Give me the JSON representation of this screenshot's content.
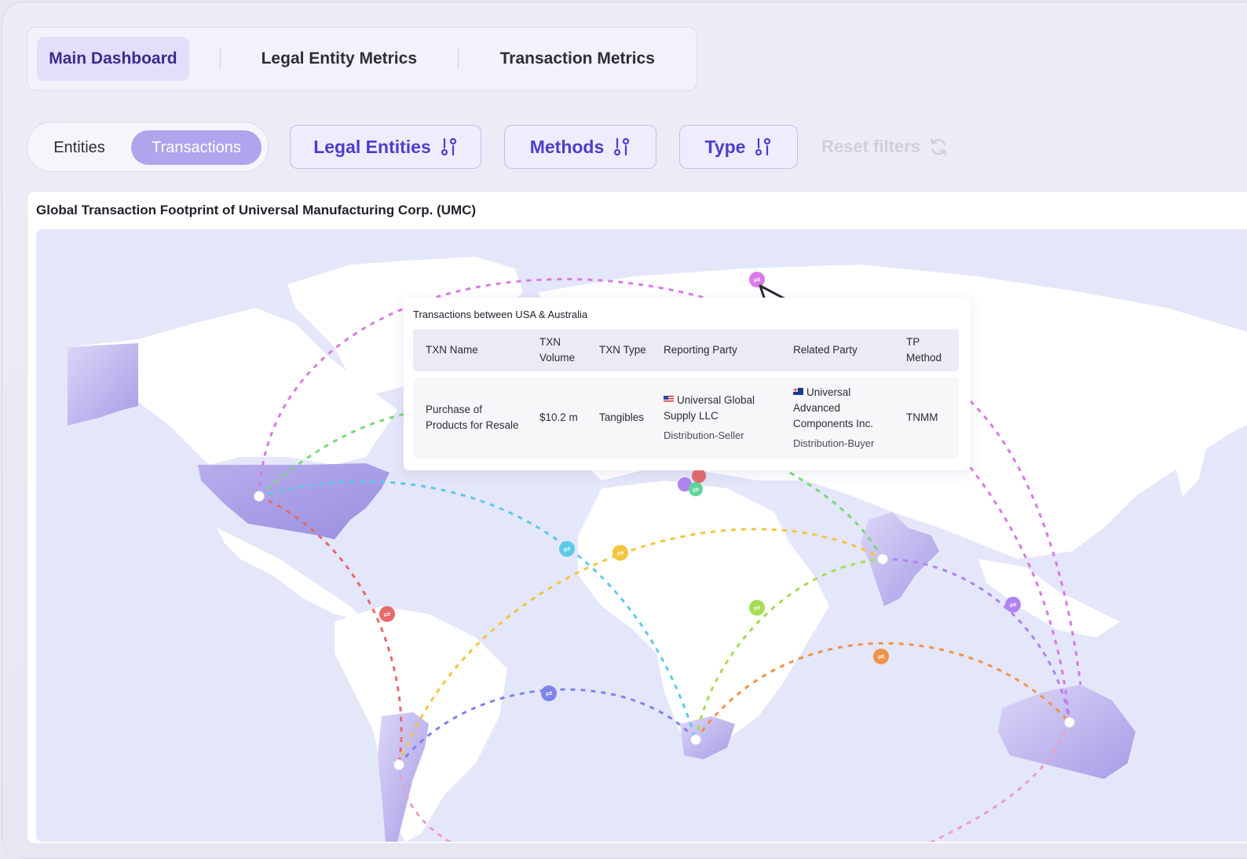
{
  "tabs": [
    {
      "label": "Main Dashboard",
      "active": true
    },
    {
      "label": "Legal Entity Metrics",
      "active": false
    },
    {
      "label": "Transaction Metrics",
      "active": false
    }
  ],
  "view_toggle": {
    "entities": "Entities",
    "transactions": "Transactions",
    "selected": "Transactions"
  },
  "filters": {
    "legal_entities": "Legal Entities",
    "methods": "Methods",
    "type": "Type",
    "reset": "Reset filters"
  },
  "card": {
    "title": "Global Transaction Footprint of Universal Manufacturing Corp. (UMC)"
  },
  "tooltip": {
    "title": "Transactions between USA & Australia",
    "headers": {
      "txn_name": "TXN Name",
      "txn_volume_1": "TXN",
      "txn_volume_2": "Volume",
      "txn_type": "TXN Type",
      "reporting_party": "Reporting Party",
      "related_party": "Related Party",
      "tp_method_1": "TP",
      "tp_method_2": "Method"
    },
    "row": {
      "txn_name_1": "Purchase of",
      "txn_name_2": "Products for Resale",
      "txn_volume": "$10.2 m",
      "txn_type": "Tangibles",
      "reporting_party_1": "Universal Global",
      "reporting_party_2": "Supply LLC",
      "reporting_role": "Distribution-Seller",
      "related_party_1": "Universal",
      "related_party_2": "Advanced",
      "related_party_3": "Components Inc.",
      "related_role": "Distribution-Buyer",
      "tp_method": "TNMM"
    }
  },
  "map": {
    "colors": {
      "pink": "#d97be6",
      "green": "#7ad87a",
      "cyan": "#5ccbe6",
      "red": "#e66a6a",
      "yellow": "#f2c53d",
      "lime": "#a5dd55",
      "purple": "#b083f0",
      "blue": "#7d84ea",
      "orange": "#f0934a",
      "rose": "#ef9ec4"
    }
  }
}
